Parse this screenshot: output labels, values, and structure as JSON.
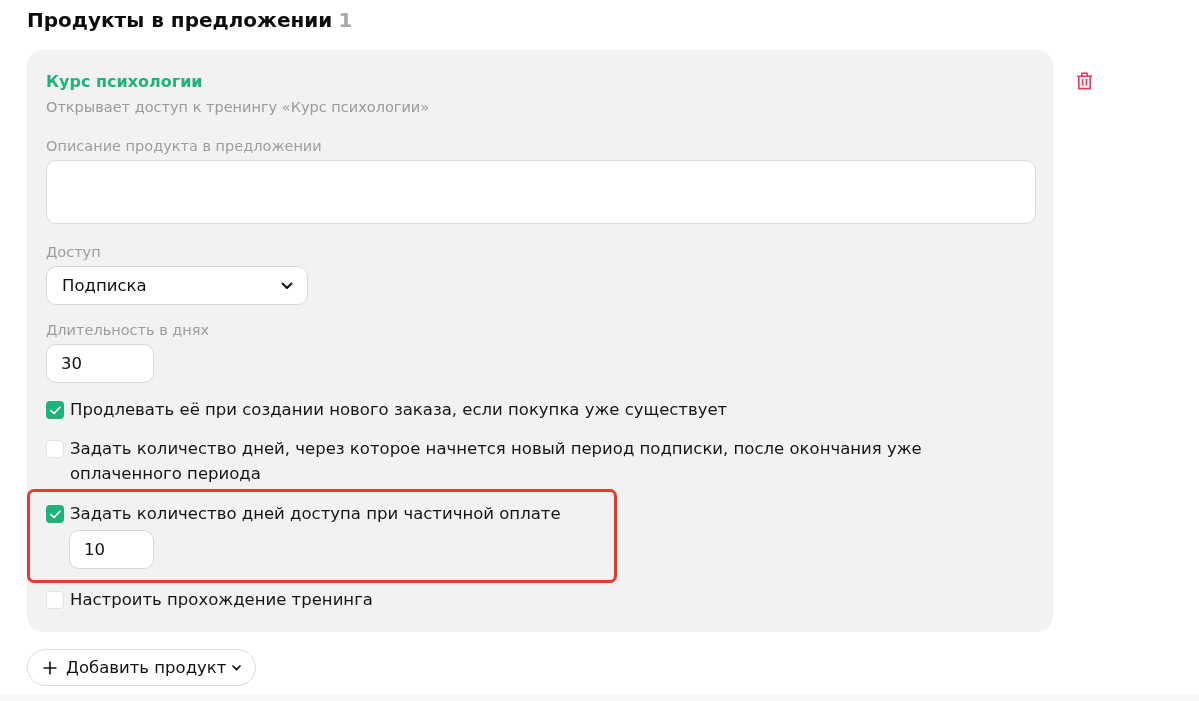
{
  "section": {
    "title": "Продукты в предложении",
    "count": "1"
  },
  "products": [
    {
      "title": "Курс психологии",
      "subtitle": "Открывает доступ к тренингу «Курс психологии»",
      "description": {
        "label": "Описание продукта в предложении"
      },
      "access": {
        "label": "Доступ",
        "value": "Подписка"
      },
      "duration": {
        "label": "Длительность в днях",
        "value": "30"
      },
      "options": [
        {
          "kind": "checkbox",
          "label": "Продлевать её при создании нового заказа, если покупка уже существует",
          "checked": true
        },
        {
          "kind": "checkbox",
          "label": "Задать количество дней, через которое начнется новый период подписки, после окончания уже оплаченного периода",
          "checked": false
        },
        {
          "kind": "checkbox_input",
          "label": "Задать количество дней доступа при частичной оплате",
          "checked": true,
          "highlighted": true,
          "value": "10"
        },
        {
          "kind": "checkbox",
          "label": "Настроить прохождение тренинга",
          "checked": false
        }
      ]
    }
  ],
  "add_button": {
    "label": "Добавить продукт"
  }
}
